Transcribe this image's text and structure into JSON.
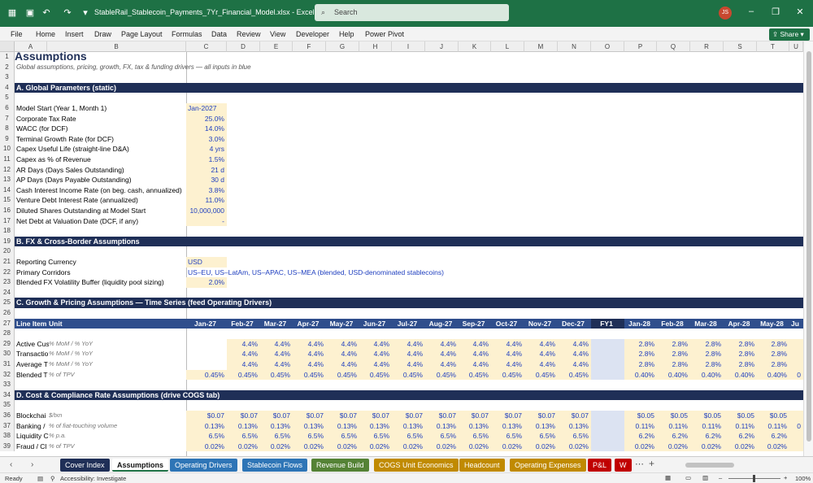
{
  "window": {
    "title": "StableRail_Stablecoin_Payments_7Yr_Financial_Model.xlsx  -  Excel",
    "search_placeholder": "Search",
    "user_initials": "JS"
  },
  "menu": [
    "File",
    "Home",
    "Insert",
    "Draw",
    "Page Layout",
    "Formulas",
    "Data",
    "Review",
    "View",
    "Developer",
    "Help",
    "Power Pivot"
  ],
  "share_label": "Share",
  "columns": [
    "A",
    "B",
    "C",
    "D",
    "E",
    "F",
    "G",
    "H",
    "I",
    "J",
    "K",
    "L",
    "M",
    "N",
    "O",
    "P",
    "Q",
    "R",
    "S",
    "T",
    "U"
  ],
  "rows": [
    {
      "n": "1",
      "type": "title",
      "b": "Assumptions"
    },
    {
      "n": "2",
      "type": "subtitle",
      "b": "Global assumptions, pricing, growth, FX, tax & funding drivers — all inputs in blue"
    },
    {
      "n": "3",
      "type": "blank"
    },
    {
      "n": "4",
      "type": "section",
      "b": "A. Global Parameters (static)"
    },
    {
      "n": "5",
      "type": "blank"
    },
    {
      "n": "6",
      "type": "param",
      "b": "Model Start (Year 1, Month 1)",
      "c": "Jan-2027",
      "align": "left"
    },
    {
      "n": "7",
      "type": "param",
      "b": "Corporate Tax Rate",
      "c": "25.0%"
    },
    {
      "n": "8",
      "type": "param",
      "b": "WACC (for DCF)",
      "c": "14.0%"
    },
    {
      "n": "9",
      "type": "param",
      "b": "Terminal Growth Rate (for DCF)",
      "c": "3.0%"
    },
    {
      "n": "10",
      "type": "param",
      "b": "Capex Useful Life (straight-line D&A)",
      "c": "4 yrs"
    },
    {
      "n": "11",
      "type": "param",
      "b": "Capex as % of Revenue",
      "c": "1.5%"
    },
    {
      "n": "12",
      "type": "param",
      "b": "AR Days (Days Sales Outstanding)",
      "c": "21 d"
    },
    {
      "n": "13",
      "type": "param",
      "b": "AP Days (Days Payable Outstanding)",
      "c": "30 d"
    },
    {
      "n": "14",
      "type": "param",
      "b": "Cash Interest Income Rate (on beg. cash, annualized)",
      "c": "3.8%"
    },
    {
      "n": "15",
      "type": "param",
      "b": "Venture Debt Interest Rate (annualized)",
      "c": "11.0%"
    },
    {
      "n": "16",
      "type": "param",
      "b": "Diluted Shares Outstanding at Model Start",
      "c": "10,000,000"
    },
    {
      "n": "17",
      "type": "param",
      "b": "Net Debt at Valuation Date (DCF, if any)",
      "c": "-"
    },
    {
      "n": "18",
      "type": "blank"
    },
    {
      "n": "19",
      "type": "section",
      "b": "B. FX & Cross-Border Assumptions"
    },
    {
      "n": "20",
      "type": "blank"
    },
    {
      "n": "21",
      "type": "param",
      "b": "Reporting Currency",
      "c": "USD",
      "align": "left"
    },
    {
      "n": "22",
      "type": "param",
      "b": "Primary Corridors",
      "c": "US–EU, US–LatAm, US–APAC, US–MEA (blended, USD-denominated stablecoins)",
      "align": "left",
      "wide": true
    },
    {
      "n": "23",
      "type": "param",
      "b": "Blended FX Volatility Buffer (liquidity pool sizing)",
      "c": "2.0%"
    },
    {
      "n": "24",
      "type": "blank"
    },
    {
      "n": "25",
      "type": "section",
      "b": "C. Growth & Pricing Assumptions — Time Series (feed Operating Drivers)"
    },
    {
      "n": "26",
      "type": "blank"
    },
    {
      "n": "27",
      "type": "header",
      "b": "Line Item",
      "unit": "Unit",
      "vals": [
        "Jan-27",
        "Feb-27",
        "Mar-27",
        "Apr-27",
        "May-27",
        "Jun-27",
        "Jul-27",
        "Aug-27",
        "Sep-27",
        "Oct-27",
        "Nov-27",
        "Dec-27",
        "FY1",
        "Jan-28",
        "Feb-28",
        "Mar-28",
        "Apr-28",
        "May-28",
        "Ju"
      ]
    },
    {
      "n": "28",
      "type": "blank"
    },
    {
      "n": "29",
      "type": "series",
      "b": "Active Cus",
      "unit": "% MoM / % YoY",
      "vals": [
        "",
        "4.4%",
        "4.4%",
        "4.4%",
        "4.4%",
        "4.4%",
        "4.4%",
        "4.4%",
        "4.4%",
        "4.4%",
        "4.4%",
        "4.4%",
        "",
        "2.8%",
        "2.8%",
        "2.8%",
        "2.8%",
        "2.8%",
        ""
      ]
    },
    {
      "n": "30",
      "type": "series",
      "b": "Transactio",
      "unit": "% MoM / % YoY",
      "vals": [
        "",
        "4.4%",
        "4.4%",
        "4.4%",
        "4.4%",
        "4.4%",
        "4.4%",
        "4.4%",
        "4.4%",
        "4.4%",
        "4.4%",
        "4.4%",
        "",
        "2.8%",
        "2.8%",
        "2.8%",
        "2.8%",
        "2.8%",
        ""
      ]
    },
    {
      "n": "31",
      "type": "series",
      "b": "Average T",
      "unit": "% MoM / % YoY",
      "vals": [
        "",
        "4.4%",
        "4.4%",
        "4.4%",
        "4.4%",
        "4.4%",
        "4.4%",
        "4.4%",
        "4.4%",
        "4.4%",
        "4.4%",
        "4.4%",
        "",
        "2.8%",
        "2.8%",
        "2.8%",
        "2.8%",
        "2.8%",
        ""
      ]
    },
    {
      "n": "32",
      "type": "series",
      "b": "Blended T",
      "unit": "% of TPV",
      "vals": [
        "0.45%",
        "0.45%",
        "0.45%",
        "0.45%",
        "0.45%",
        "0.45%",
        "0.45%",
        "0.45%",
        "0.45%",
        "0.45%",
        "0.45%",
        "0.45%",
        "",
        "0.40%",
        "0.40%",
        "0.40%",
        "0.40%",
        "0.40%",
        "0"
      ]
    },
    {
      "n": "33",
      "type": "blank"
    },
    {
      "n": "34",
      "type": "section",
      "b": "D. Cost & Compliance Rate Assumptions (drive COGS tab)"
    },
    {
      "n": "35",
      "type": "blank"
    },
    {
      "n": "36",
      "type": "series",
      "b": "Blockchai",
      "unit": "$/txn",
      "vals": [
        "$0.07",
        "$0.07",
        "$0.07",
        "$0.07",
        "$0.07",
        "$0.07",
        "$0.07",
        "$0.07",
        "$0.07",
        "$0.07",
        "$0.07",
        "$0.07",
        "",
        "$0.05",
        "$0.05",
        "$0.05",
        "$0.05",
        "$0.05",
        ""
      ]
    },
    {
      "n": "37",
      "type": "series",
      "b": "Banking /",
      "unit": "% of fiat-touching volume",
      "vals": [
        "0.13%",
        "0.13%",
        "0.13%",
        "0.13%",
        "0.13%",
        "0.13%",
        "0.13%",
        "0.13%",
        "0.13%",
        "0.13%",
        "0.13%",
        "0.13%",
        "",
        "0.11%",
        "0.11%",
        "0.11%",
        "0.11%",
        "0.11%",
        "0"
      ]
    },
    {
      "n": "38",
      "type": "series",
      "b": "Liquidity C",
      "unit": "% p.a.",
      "vals": [
        "6.5%",
        "6.5%",
        "6.5%",
        "6.5%",
        "6.5%",
        "6.5%",
        "6.5%",
        "6.5%",
        "6.5%",
        "6.5%",
        "6.5%",
        "6.5%",
        "",
        "6.2%",
        "6.2%",
        "6.2%",
        "6.2%",
        "6.2%",
        ""
      ]
    },
    {
      "n": "39",
      "type": "series",
      "b": "Fraud / Cl",
      "unit": "% of TPV",
      "vals": [
        "0.02%",
        "0.02%",
        "0.02%",
        "0.02%",
        "0.02%",
        "0.02%",
        "0.02%",
        "0.02%",
        "0.02%",
        "0.02%",
        "0.02%",
        "0.02%",
        "",
        "0.02%",
        "0.02%",
        "0.02%",
        "0.02%",
        "0.02%",
        ""
      ]
    }
  ],
  "tabs": [
    {
      "label": "Cover Index",
      "color": "#1f2f57"
    },
    {
      "label": "Assumptions",
      "color": "active"
    },
    {
      "label": "Operating Drivers",
      "color": "#2e75b6"
    },
    {
      "label": "Stablecoin Flows",
      "color": "#2e75b6"
    },
    {
      "label": "Revenue Build",
      "color": "#548235"
    },
    {
      "label": "COGS Unit Economics",
      "color": "#c08a00"
    },
    {
      "label": "Headcount",
      "color": "#c08a00"
    },
    {
      "label": "Operating Expenses",
      "color": "#c08a00"
    },
    {
      "label": "P&L",
      "color": "#c00000"
    },
    {
      "label": "W",
      "color": "#c00000"
    }
  ],
  "status": {
    "ready": "Ready",
    "accessibility": "Accessibility: Investigate",
    "zoom": "100%"
  }
}
